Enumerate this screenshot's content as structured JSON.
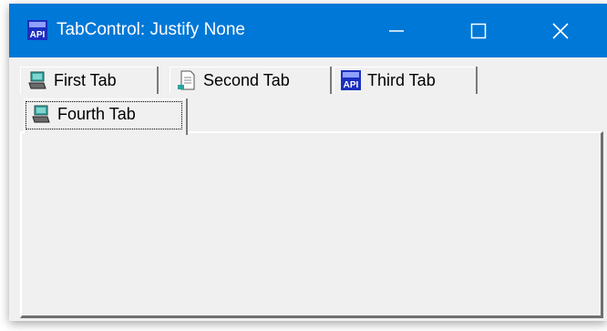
{
  "window": {
    "title": "TabControl: Justify None",
    "app_icon": "api-logo-icon",
    "controls": {
      "minimize": "minimize-icon",
      "maximize": "maximize-icon",
      "close": "close-icon"
    },
    "titlebar_color": "#0078d7"
  },
  "tabs": [
    {
      "label": "First Tab",
      "icon": "workstation-icon",
      "selected": false
    },
    {
      "label": "Second Tab",
      "icon": "document-icon",
      "selected": false
    },
    {
      "label": "Third Tab",
      "icon": "api-logo-icon",
      "selected": false
    },
    {
      "label": "Fourth Tab",
      "icon": "workstation-icon",
      "selected": true
    }
  ]
}
